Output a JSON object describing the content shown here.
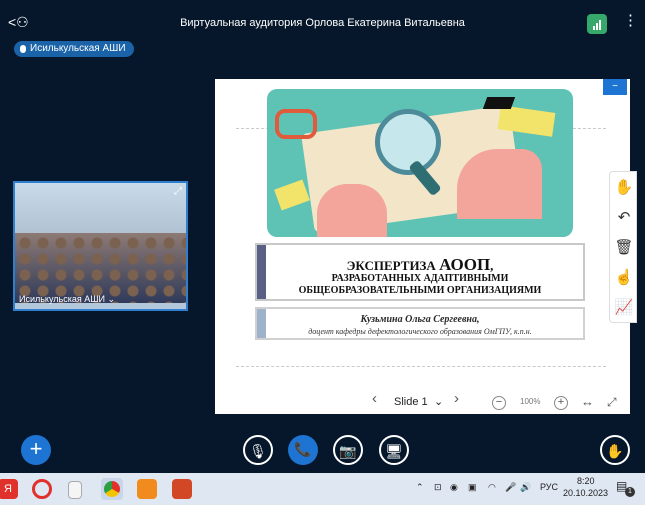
{
  "header": {
    "back_icon": "back-user-icon",
    "title": "Виртуальная аудитория Орлова Екатерина Витальевна",
    "signal_icon": "signal-icon",
    "menu_icon": "more-vert-icon",
    "signal_color": "#35a86a"
  },
  "room": {
    "label": "Исилькульская АШИ",
    "color": "#1a63a8"
  },
  "video": {
    "label": "Исилькульская АШИ ⌄"
  },
  "slide": {
    "title_line1_a": "ЭКСПЕРТИЗА ",
    "title_line1_b": "АООП",
    "title_line1_c": ",",
    "title_line2": "РАЗРАБОТАННЫХ АДАПТИВНЫМИ",
    "title_line3": "ОБЩЕОБРАЗОВАТЕЛЬНЫМИ ОРГАНИЗАЦИЯМИ",
    "author": "Кузьмина Ольга Сергеевна,",
    "position": "доцент кафедры дефектологического образования ОмГПУ, к.п.н."
  },
  "slide_controls": {
    "prev": "‹",
    "slide_label": "Slide 1",
    "dropdown": "⌄",
    "next": "›",
    "zoom_out": "−",
    "zoom": "100%",
    "zoom_in": "+",
    "fit_width": "↔",
    "fullscreen": "⤢"
  },
  "tools": [
    {
      "name": "hand-tool-icon",
      "glyph": "✋"
    },
    {
      "name": "undo-icon",
      "glyph": "↶"
    },
    {
      "name": "trash-icon",
      "glyph": "🗑"
    },
    {
      "name": "pointer-icon",
      "glyph": "☝"
    },
    {
      "name": "chart-icon",
      "glyph": "📈"
    }
  ],
  "controls": {
    "add": "+",
    "mic": "🎙",
    "phone": "📞",
    "camera": "📷",
    "screen": "🖥",
    "raise_hand": "✋",
    "accent": "#1d74d3"
  },
  "taskbar": {
    "tray_lang": "РУС",
    "time": "8:20",
    "date": "20.10.2023",
    "notifications": "1"
  }
}
